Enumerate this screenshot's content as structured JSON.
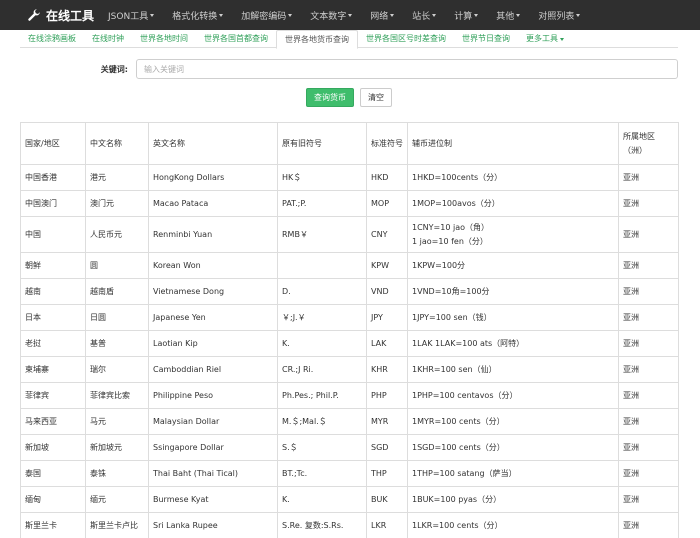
{
  "navbar": {
    "brand": "在线工具",
    "items": [
      {
        "label": "JSON工具",
        "dropdown": true
      },
      {
        "label": "格式化转换",
        "dropdown": true
      },
      {
        "label": "加解密编码",
        "dropdown": true
      },
      {
        "label": "文本数字",
        "dropdown": true
      },
      {
        "label": "网络",
        "dropdown": true
      },
      {
        "label": "站长",
        "dropdown": true
      },
      {
        "label": "计算",
        "dropdown": true
      },
      {
        "label": "其他",
        "dropdown": true
      },
      {
        "label": "对照列表",
        "dropdown": true
      }
    ]
  },
  "subnav": {
    "tabs": [
      {
        "label": "在线涂鸦画板"
      },
      {
        "label": "在线时钟"
      },
      {
        "label": "世界各地时间"
      },
      {
        "label": "世界各国首都查询"
      },
      {
        "label": "世界各地货币查询",
        "active": true
      },
      {
        "label": "世界各国区号时差查询"
      },
      {
        "label": "世界节日查询"
      },
      {
        "label": "更多工具",
        "dropdown": true
      }
    ]
  },
  "search": {
    "label": "关键词:",
    "placeholder": "输入关键词",
    "value": ""
  },
  "buttons": {
    "query": "查询货币",
    "clear": "清空"
  },
  "table": {
    "headers": [
      "国家/地区",
      "中文名称",
      "英文名称",
      "原有旧符号",
      "标准符号",
      "辅币进位制",
      "所属地区（洲）"
    ],
    "rows": [
      [
        "中国香港",
        "港元",
        "HongKong Dollars",
        "HK＄",
        "HKD",
        "1HKD=100cents（分）",
        "亚洲"
      ],
      [
        "中国澳门",
        "澳门元",
        "Macao Pataca",
        "PAT.;P.",
        "MOP",
        "1MOP=100avos（分）",
        "亚洲"
      ],
      [
        "中国",
        "人民币元",
        "Renminbi Yuan",
        "RMB￥",
        "CNY",
        "1CNY=10 jao（角）|1 jao=10 fen（分）",
        "亚洲"
      ],
      [
        "朝鲜",
        "圆",
        "Korean Won",
        "",
        "KPW",
        "1KPW=100分",
        "亚洲"
      ],
      [
        "越南",
        "越南盾",
        "Vietnamese Dong",
        "D.",
        "VND",
        "1VND=10角=100分",
        "亚洲"
      ],
      [
        "日本",
        "日圆",
        "Japanese Yen",
        "￥;J.￥",
        "JPY",
        "1JPY=100 sen（钱）",
        "亚洲"
      ],
      [
        "老挝",
        "基普",
        "Laotian Kip",
        "K.",
        "LAK",
        "1LAK 1LAK=100 ats（阿特）",
        "亚洲"
      ],
      [
        "柬埔寨",
        "瑞尔",
        "Camboddian Riel",
        "CR.;J Ri.",
        "KHR",
        "1KHR=100 sen（仙）",
        "亚洲"
      ],
      [
        "菲律宾",
        "菲律宾比索",
        "Philippine Peso",
        "Ph.Pes.; Phil.P.",
        "PHP",
        "1PHP=100 centavos（分）",
        "亚洲"
      ],
      [
        "马来西亚",
        "马元",
        "Malaysian Dollar",
        "M.＄;Mal.＄",
        "MYR",
        "1MYR=100 cents（分）",
        "亚洲"
      ],
      [
        "新加坡",
        "新加坡元",
        "Ssingapore Dollar",
        "S.＄",
        "SGD",
        "1SGD=100 cents（分）",
        "亚洲"
      ],
      [
        "泰国",
        "泰铢",
        "Thai Baht (Thai Tical)",
        "BT.;Tc.",
        "THP",
        "1THP=100 satang（萨当）",
        "亚洲"
      ],
      [
        "缅甸",
        "缅元",
        "Burmese Kyat",
        "K.",
        "BUK",
        "1BUK=100 pyas（分）",
        "亚洲"
      ],
      [
        "斯里兰卡",
        "斯里兰卡卢比",
        "Sri Lanka Rupee",
        "S.Re. 复数:S.Rs.",
        "LKR",
        "1LKR=100 cents（分）",
        "亚洲"
      ]
    ]
  },
  "colors": {
    "navbar_bg": "#2f2f2f",
    "accent_green": "#3fbd6c",
    "link_green": "#30a05a",
    "border": "#dddddd"
  },
  "icons": {
    "brand": "wrench-icon"
  }
}
